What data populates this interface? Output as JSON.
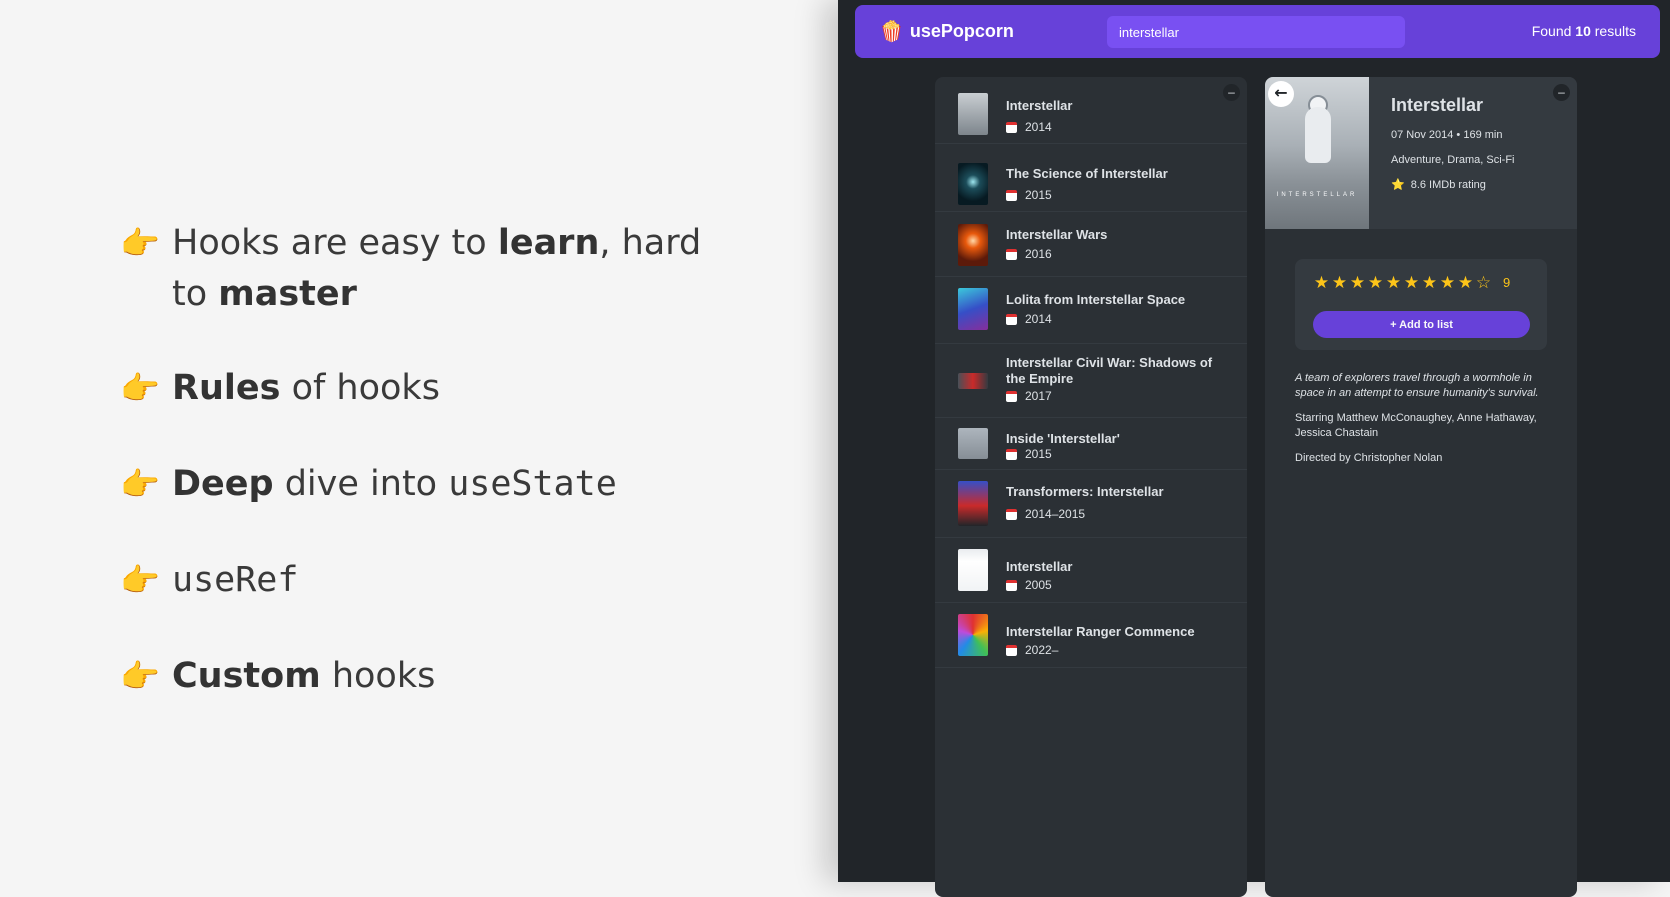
{
  "slide": {
    "bullets": [
      {
        "pre": "Hooks are easy to ",
        "b1": "learn",
        "mid": ", hard to ",
        "b2": "master"
      },
      {
        "b": "Rules",
        "rest": " of hooks"
      },
      {
        "b": "Deep",
        "mid": " dive into ",
        "code": "useState"
      },
      {
        "code": "useRef"
      },
      {
        "b": "Custom",
        "rest": " hooks"
      }
    ],
    "hand_emoji": "👉"
  },
  "app": {
    "logo": {
      "emoji": "🍿",
      "text": "usePopcorn"
    },
    "search": {
      "value": "interstellar"
    },
    "found": {
      "pre": "Found ",
      "count": "10",
      "post": " results"
    },
    "toggle_label": "–",
    "movies": [
      {
        "title": "Interstellar",
        "year": "2014"
      },
      {
        "title": "The Science of Interstellar",
        "year": "2015"
      },
      {
        "title": "Interstellar Wars",
        "year": "2016"
      },
      {
        "title": "Lolita from Interstellar Space",
        "year": "2014"
      },
      {
        "title": "Interstellar Civil War: Shadows of the Empire",
        "year": "2017"
      },
      {
        "title": "Inside 'Interstellar'",
        "year": "2015"
      },
      {
        "title": "Transformers: Interstellar",
        "year": "2014–2015"
      },
      {
        "title": "Interstellar",
        "year": "2005"
      },
      {
        "title": "Interstellar Ranger Commence",
        "year": "2022–"
      }
    ],
    "detail": {
      "back": "←",
      "poster_text": "INTERSTELLAR",
      "title": "Interstellar",
      "released_runtime": "07 Nov 2014 • 169 min",
      "genre": "Adventure, Drama, Sci-Fi",
      "imdb_star": "⭐",
      "imdb": "8.6 IMDb rating",
      "rating": {
        "value": 9,
        "max": 10,
        "label": "9"
      },
      "add_button": "+ Add to list",
      "plot": "A team of explorers travel through a wormhole in space in an attempt to ensure humanity's survival.",
      "starring": "Starring Matthew McConaughey, Anne Hathaway, Jessica Chastain",
      "director": "Directed by Christopher Nolan"
    },
    "colors": {
      "accent": "#6741d9",
      "accent_light": "#7950f2",
      "star": "#fcc419",
      "bg": "#212529",
      "box": "#2b3035"
    }
  }
}
